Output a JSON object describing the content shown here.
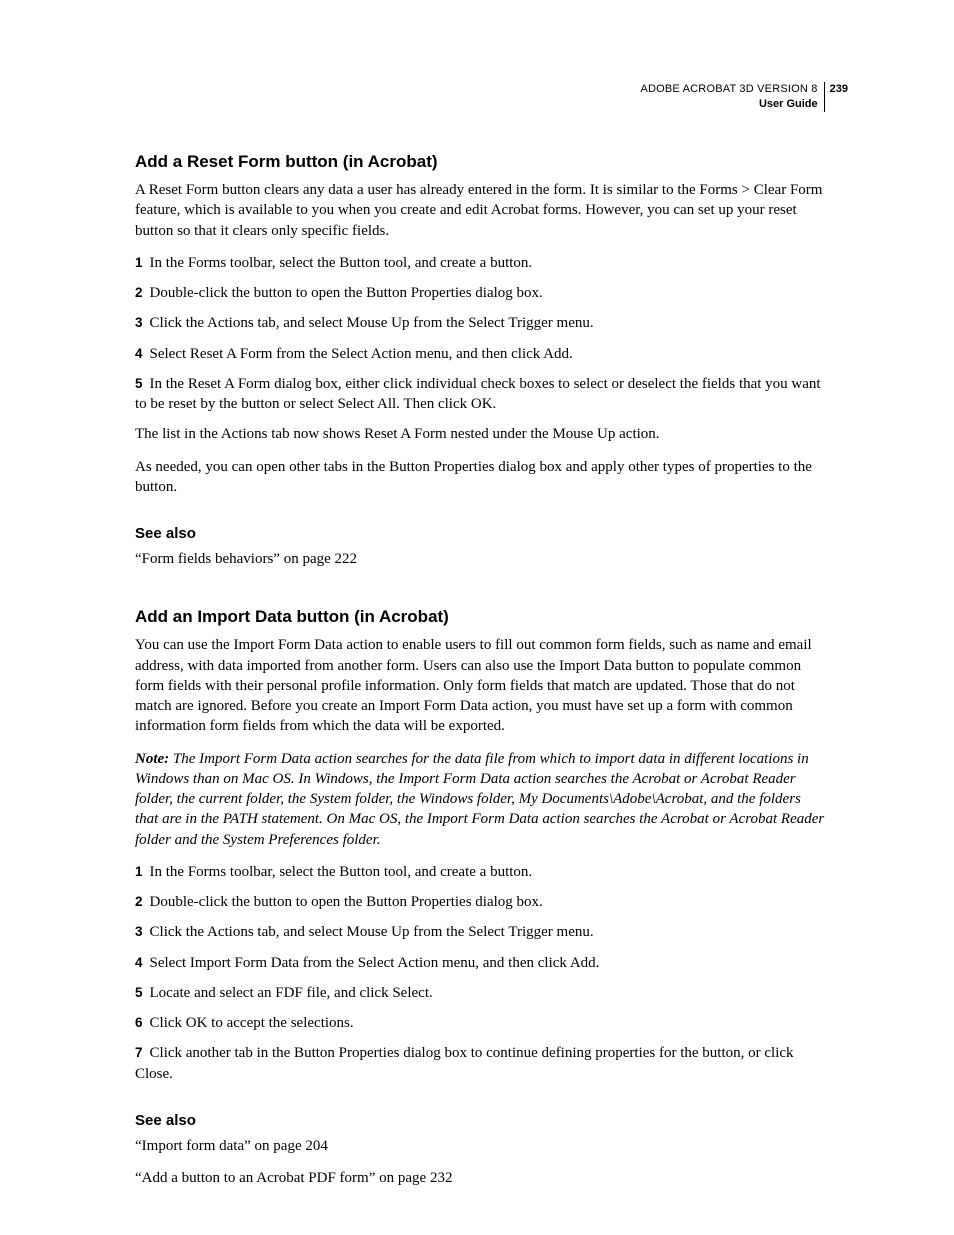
{
  "header": {
    "product": "ADOBE ACROBAT 3D VERSION 8",
    "guide": "User Guide",
    "page_number": "239"
  },
  "section1": {
    "heading": "Add a Reset Form button (in Acrobat)",
    "intro": "A Reset Form button clears any data a user has already entered in the form. It is similar to the Forms > Clear Form feature, which is available to you when you create and edit Acrobat forms. However, you can set up your reset button so that it clears only specific fields.",
    "steps": [
      {
        "n": "1",
        "t": "In the Forms toolbar, select the Button tool, and create a button."
      },
      {
        "n": "2",
        "t": "Double-click the button to open the Button Properties dialog box."
      },
      {
        "n": "3",
        "t": "Click the Actions tab, and select Mouse Up from the Select Trigger menu."
      },
      {
        "n": "4",
        "t": "Select Reset A Form from the Select Action menu, and then click Add."
      },
      {
        "n": "5",
        "t": "In the Reset A Form dialog box, either click individual check boxes to select or deselect the fields that you want to be reset by the button or select Select All. Then click OK."
      }
    ],
    "after1": "The list in the Actions tab now shows Reset A Form nested under the Mouse Up action.",
    "after2": "As needed, you can open other tabs in the Button Properties dialog box and apply other types of properties to the button.",
    "see_also_heading": "See also",
    "see_also_link": "“Form fields behaviors” on page 222"
  },
  "section2": {
    "heading": "Add an Import Data button (in Acrobat)",
    "intro": "You can use the Import Form Data action to enable users to fill out common form fields, such as name and email address, with data imported from another form. Users can also use the Import Data button to populate common form fields with their personal profile information. Only form fields that match are updated. Those that do not match are ignored. Before you create an Import Form Data action, you must have set up a form with common information form fields from which the data will be exported.",
    "note_label": "Note:",
    "note_body": " The Import Form Data action searches for the data file from which to import data in different locations in Windows than on Mac OS. In Windows, the Import Form Data action searches the Acrobat or Acrobat Reader folder, the current folder, the System folder, the Windows folder, My Documents\\Adobe\\Acrobat, and the folders that are in the PATH statement. On Mac OS, the Import Form Data action searches the Acrobat or Acrobat Reader folder and the System Preferences folder.",
    "steps": [
      {
        "n": "1",
        "t": "In the Forms toolbar, select the Button tool, and create a button."
      },
      {
        "n": "2",
        "t": "Double-click the button to open the Button Properties dialog box."
      },
      {
        "n": "3",
        "t": "Click the Actions tab, and select Mouse Up from the Select Trigger menu."
      },
      {
        "n": "4",
        "t": "Select Import Form Data from the Select Action menu, and then click Add."
      },
      {
        "n": "5",
        "t": "Locate and select an FDF file, and click Select."
      },
      {
        "n": "6",
        "t": "Click OK to accept the selections."
      },
      {
        "n": "7",
        "t": "Click another tab in the Button Properties dialog box to continue defining properties for the button, or click Close."
      }
    ],
    "see_also_heading": "See also",
    "see_also_links": [
      "“Import form data” on page 204",
      "“Add a button to an Acrobat PDF form” on page 232"
    ]
  }
}
